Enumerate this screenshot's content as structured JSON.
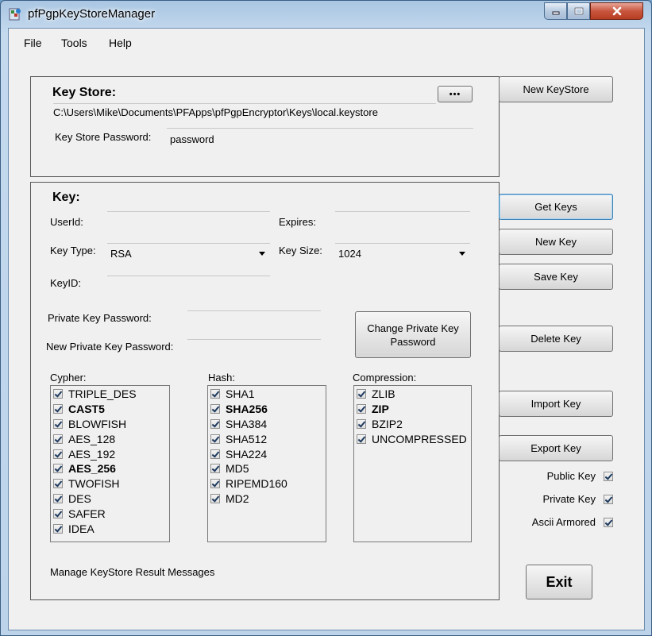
{
  "window": {
    "title": "pfPgpKeyStoreManager"
  },
  "menu": [
    "File",
    "Tools",
    "Help"
  ],
  "keystore": {
    "heading": "Key Store:",
    "browse_label": "•••",
    "path": "C:\\Users\\Mike\\Documents\\PFApps\\pfPgpEncryptor\\Keys\\local.keystore",
    "password_label": "Key Store Password:",
    "password_value": "password"
  },
  "key": {
    "heading": "Key:",
    "userid_label": "UserId:",
    "userid_value": "",
    "expires_label": "Expires:",
    "expires_value": "",
    "keytype_label": "Key Type:",
    "keytype_value": "RSA",
    "keysize_label": "Key Size:",
    "keysize_value": "1024",
    "keyid_label": "KeyID:",
    "keyid_value": "",
    "private_pw_label": "Private Key Password:",
    "new_private_pw_label": "New Private Key Password:",
    "change_pw_button": "Change Private Key Password",
    "result_messages": "Manage KeyStore Result Messages"
  },
  "cypher": {
    "label": "Cypher:",
    "items": [
      "TRIPLE_DES",
      "CAST5",
      "BLOWFISH",
      "AES_128",
      "AES_192",
      "AES_256",
      "TWOFISH",
      "DES",
      "SAFER",
      "IDEA"
    ],
    "bold": [
      false,
      true,
      false,
      false,
      false,
      true,
      false,
      false,
      false,
      false
    ]
  },
  "hash": {
    "label": "Hash:",
    "items": [
      "SHA1",
      "SHA256",
      "SHA384",
      "SHA512",
      "SHA224",
      "MD5",
      "RIPEMD160",
      "MD2"
    ],
    "bold": [
      false,
      true,
      false,
      false,
      false,
      false,
      false,
      false
    ]
  },
  "compression": {
    "label": "Compression:",
    "items": [
      "ZLIB",
      "ZIP",
      "BZIP2",
      "UNCOMPRESSED"
    ],
    "bold": [
      false,
      true,
      false,
      false
    ]
  },
  "buttons": {
    "new_keystore": "New KeyStore",
    "get_keys": "Get Keys",
    "new_key": "New Key",
    "save_key": "Save Key",
    "delete_key": "Delete Key",
    "import_key": "Import Key",
    "export_key": "Export Key",
    "exit": "Exit"
  },
  "options": {
    "public_key": "Public Key",
    "private_key": "Private Key",
    "ascii_armored": "Ascii Armored"
  }
}
